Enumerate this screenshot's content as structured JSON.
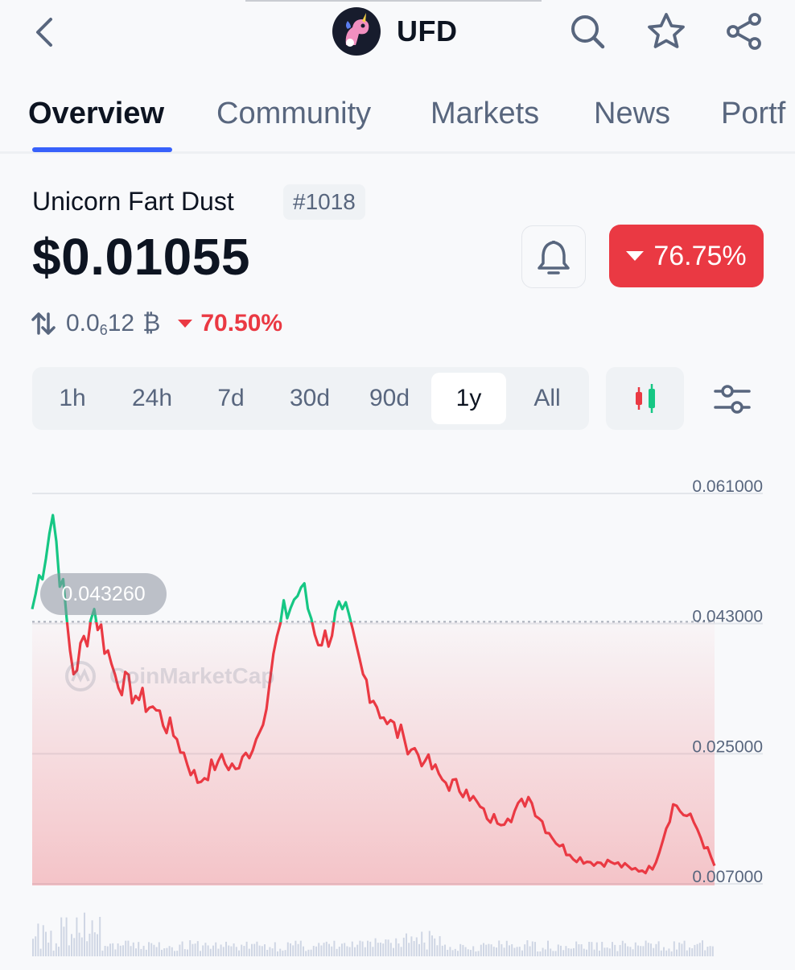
{
  "header": {
    "symbol": "UFD"
  },
  "tabs": [
    {
      "label": "Overview"
    },
    {
      "label": "Community"
    },
    {
      "label": "Markets"
    },
    {
      "label": "News"
    },
    {
      "label": "Portf"
    }
  ],
  "coin": {
    "name": "Unicorn Fart Dust",
    "rank": "#1018",
    "price": "$0.01055",
    "change_pct": "76.75%",
    "change_direction": "down",
    "btc_price_prefix": "0.0",
    "btc_price_zero_count": "6",
    "btc_price_digits": "12",
    "btc_symbol": "₿",
    "btc_change_pct": "70.50%"
  },
  "range": {
    "options": [
      "1h",
      "24h",
      "7d",
      "30d",
      "90d",
      "1y",
      "All"
    ],
    "selected": "1y"
  },
  "chart": {
    "hover_value": "0.043260",
    "watermark": "CoinMarketCap"
  },
  "colors": {
    "accent": "#3861fb",
    "down": "#ea3943",
    "up": "#16c784",
    "text_primary": "#0d1421",
    "text_secondary": "#58667e"
  },
  "chart_data": {
    "type": "line",
    "reference_value": 0.04326,
    "ylim": [
      0.007,
      0.061
    ],
    "y_ticks": [
      "0.061000",
      "0.043000",
      "0.025000",
      "0.007000"
    ],
    "grid": true,
    "x_index": [
      0,
      3,
      6,
      9,
      12,
      15,
      18,
      21,
      24,
      27,
      30,
      33,
      36,
      39,
      42,
      45,
      48,
      51,
      54,
      57,
      60,
      63,
      66,
      69,
      72,
      75,
      78,
      81,
      84,
      87,
      90,
      93,
      96,
      99
    ],
    "values": [
      0.045,
      0.058,
      0.036,
      0.045,
      0.036,
      0.033,
      0.031,
      0.027,
      0.021,
      0.024,
      0.023,
      0.028,
      0.043,
      0.048,
      0.04,
      0.045,
      0.036,
      0.03,
      0.027,
      0.024,
      0.021,
      0.02,
      0.016,
      0.016,
      0.019,
      0.014,
      0.011,
      0.01,
      0.01,
      0.009,
      0.009,
      0.018,
      0.0155,
      0.0095
    ]
  }
}
